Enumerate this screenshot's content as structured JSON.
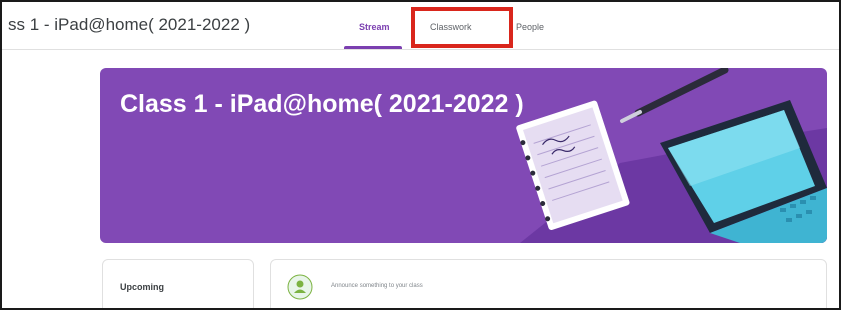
{
  "header": {
    "class_title": "ss 1 - iPad@home( 2021-2022 )",
    "tabs": [
      {
        "label": "Stream",
        "active": true
      },
      {
        "label": "Classwork",
        "active": false,
        "highlighted": true
      },
      {
        "label": "People",
        "active": false
      }
    ]
  },
  "banner": {
    "title": "Class 1 - iPad@home( 2021-2022 )",
    "color": "#8149b5",
    "illustration": "notebook-pen-laptop-illustration"
  },
  "upcoming": {
    "label": "Upcoming"
  },
  "announce": {
    "placeholder": "Announce something to your class",
    "icon": "group-icon"
  },
  "colors": {
    "accent": "#7b3fb0",
    "highlight": "#d9261c"
  }
}
